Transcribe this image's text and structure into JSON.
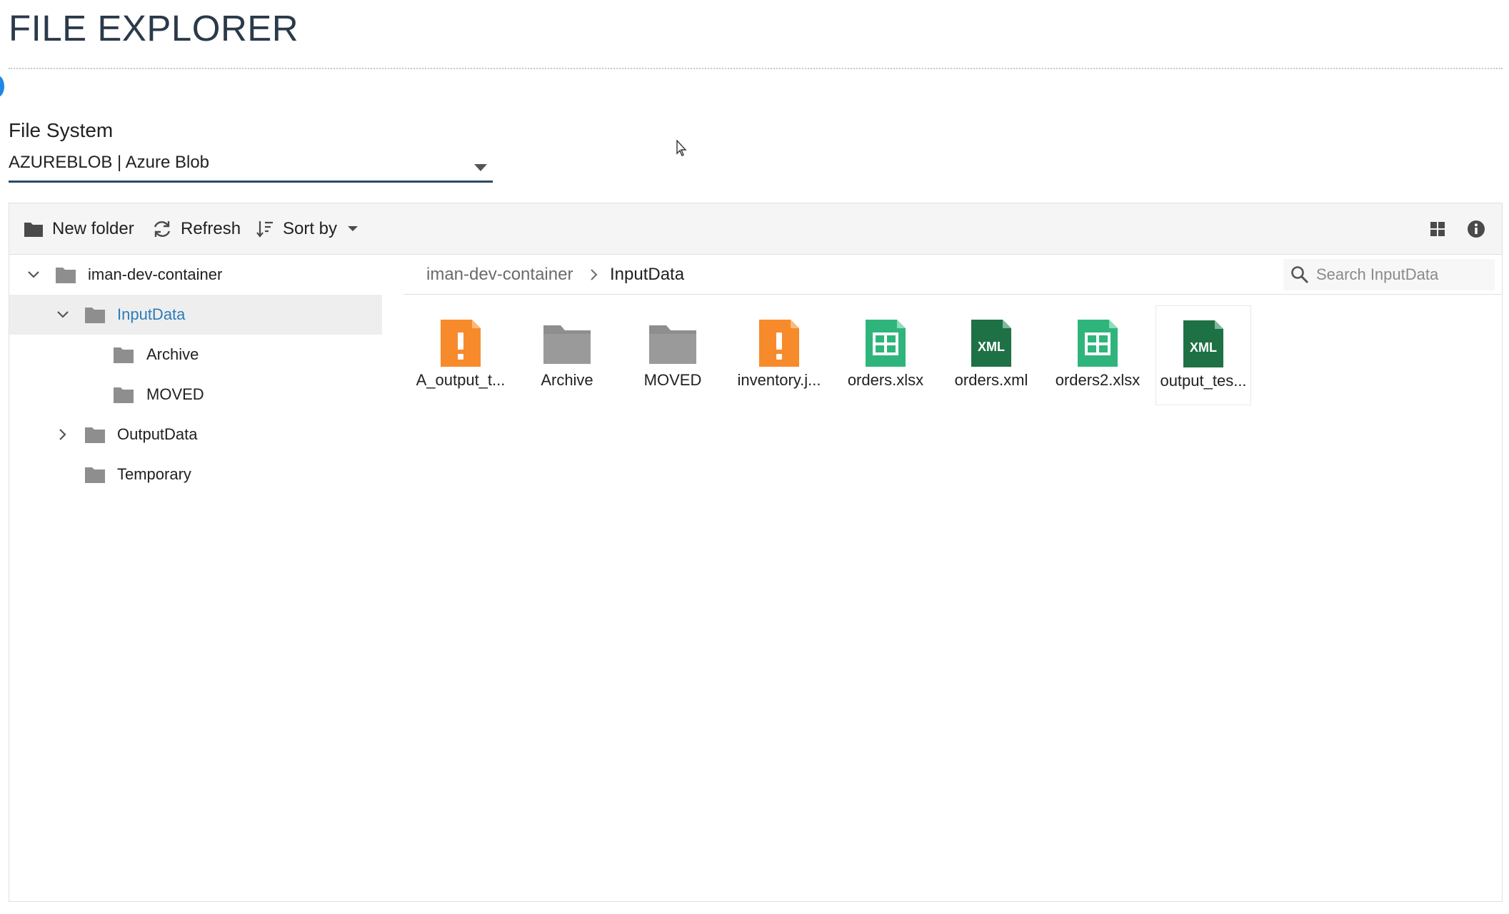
{
  "page": {
    "title": "FILE EXPLORER"
  },
  "file_system": {
    "label": "File System",
    "selected": "AZUREBLOB | Azure Blob"
  },
  "toolbar": {
    "new_folder": "New folder",
    "refresh": "Refresh",
    "sort_by": "Sort by"
  },
  "tree": {
    "root": "iman-dev-container",
    "items": [
      {
        "label": "InputData"
      },
      {
        "label": "Archive"
      },
      {
        "label": "MOVED"
      },
      {
        "label": "OutputData"
      },
      {
        "label": "Temporary"
      }
    ]
  },
  "breadcrumb": {
    "parent": "iman-dev-container",
    "current": "InputData"
  },
  "search": {
    "placeholder": "Search InputData"
  },
  "files": [
    {
      "name": "A_output_t...",
      "icon": "warning-file-icon"
    },
    {
      "name": "Archive",
      "icon": "folder-icon"
    },
    {
      "name": "MOVED",
      "icon": "folder-icon"
    },
    {
      "name": "inventory.j...",
      "icon": "warning-file-icon"
    },
    {
      "name": "orders.xlsx",
      "icon": "spreadsheet-icon"
    },
    {
      "name": "orders.xml",
      "icon": "xml-file-icon",
      "badge": "XML"
    },
    {
      "name": "orders2.xlsx",
      "icon": "spreadsheet-icon"
    },
    {
      "name": "output_tes...",
      "icon": "xml-file-icon",
      "badge": "XML"
    }
  ],
  "colors": {
    "accent": "#2d7bb8",
    "warning": "#f78a2a",
    "spreadsheet": "#2fb57c",
    "xml": "#1e7145",
    "folder": "#8e8e8e"
  }
}
